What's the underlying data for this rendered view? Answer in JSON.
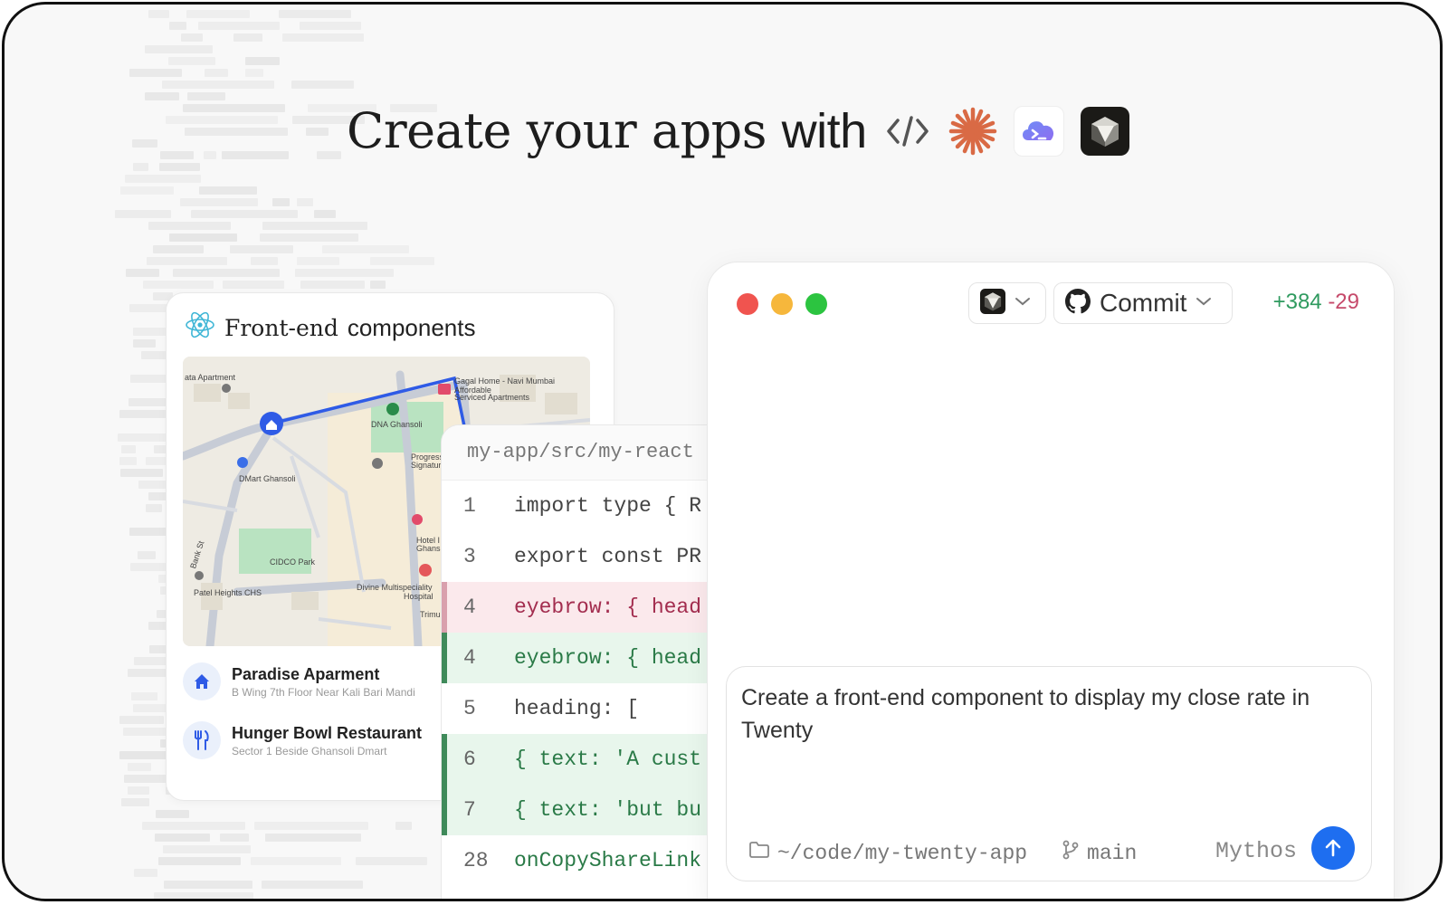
{
  "hero": {
    "title_prefix": "Create your apps",
    "title_suffix": "with",
    "tools": [
      "code-brackets-icon",
      "claude-asterisk-icon",
      "gemini-cli-icon",
      "cursor-cube-icon"
    ]
  },
  "component_card": {
    "title_light": "Front-end",
    "title_bold": "components",
    "map_labels": [
      "ata Apartment",
      "Gagal Home - Navi Mumbai",
      "Affordable",
      "Serviced Apartments",
      "DNA Ghansoli",
      "DMart Ghansoli",
      "Progressive's",
      "Signature CHS",
      "CIDCO Park",
      "Patel Heights CHS",
      "Divine Multispeciality",
      "Hospital",
      "Hotel I",
      "Ghans",
      "Trimu",
      "Bank St"
    ],
    "places": [
      {
        "name": "Paradise Aparment",
        "address": "B Wing 7th Floor Near Kali Bari Mandi"
      },
      {
        "name": "Hunger Bowl Restaurant",
        "address": "Sector 1 Beside Ghansoli Dmart"
      }
    ]
  },
  "code_panel": {
    "path": "my-app/src/my-react",
    "lines": [
      {
        "num": "1",
        "text": "import type { R",
        "state": "normal"
      },
      {
        "num": "3",
        "text": "export const PR",
        "state": "normal"
      },
      {
        "num": "4",
        "text": "eyebrow: { head",
        "state": "removed"
      },
      {
        "num": "4",
        "text": "eyebrow: { head",
        "state": "added"
      },
      {
        "num": "5",
        "text": "heading: [",
        "state": "normal"
      },
      {
        "num": "6",
        "text": "{ text: 'A cust",
        "state": "added"
      },
      {
        "num": "7",
        "text": "{ text: 'but bu",
        "state": "added"
      },
      {
        "num": "28",
        "text": "onCopyShareLink",
        "state": "green"
      }
    ]
  },
  "agent_window": {
    "commit_label": "Commit",
    "additions": "+384",
    "deletions": "-29",
    "prompt_text": "Create a front-end component to display my close rate in Twenty",
    "folder": "~/code/my-twenty-app",
    "branch": "main",
    "model": "Mythos"
  },
  "colors": {
    "accent": "#1e6ef0",
    "additions": "#2f9a5f",
    "deletions": "#c64a6b",
    "traffic_red": "#f0544f",
    "traffic_yellow": "#f6b73c",
    "traffic_green": "#2cc440"
  }
}
